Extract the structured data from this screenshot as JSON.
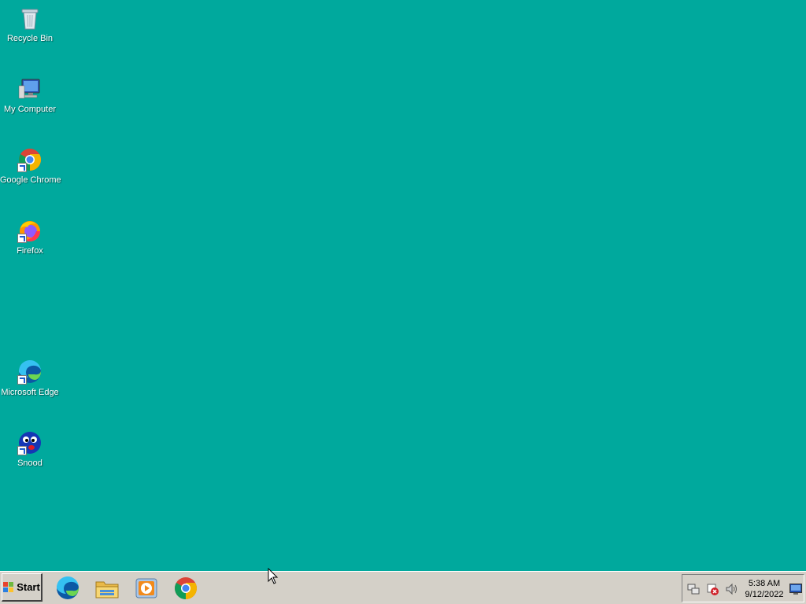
{
  "desktop": {
    "background_color": "#00a99d",
    "icons": [
      {
        "label": "Recycle Bin",
        "icon": "recycle-bin-icon"
      },
      {
        "label": "My Computer",
        "icon": "computer-icon"
      },
      {
        "label": "Google Chrome",
        "icon": "chrome-icon"
      },
      {
        "label": "Firefox",
        "icon": "firefox-icon"
      },
      {
        "label": "Microsoft Edge",
        "icon": "edge-icon"
      },
      {
        "label": "Snood",
        "icon": "snood-icon"
      }
    ]
  },
  "taskbar": {
    "start_label": "Start",
    "pinned": [
      {
        "icon": "edge-icon"
      },
      {
        "icon": "file-explorer-icon"
      },
      {
        "icon": "media-player-icon"
      },
      {
        "icon": "chrome-icon"
      }
    ],
    "tray": {
      "icons": [
        "network-icon",
        "security-alert-icon",
        "volume-icon",
        "show-desktop-icon"
      ],
      "time": "5:38 AM",
      "date": "9/12/2022"
    }
  }
}
